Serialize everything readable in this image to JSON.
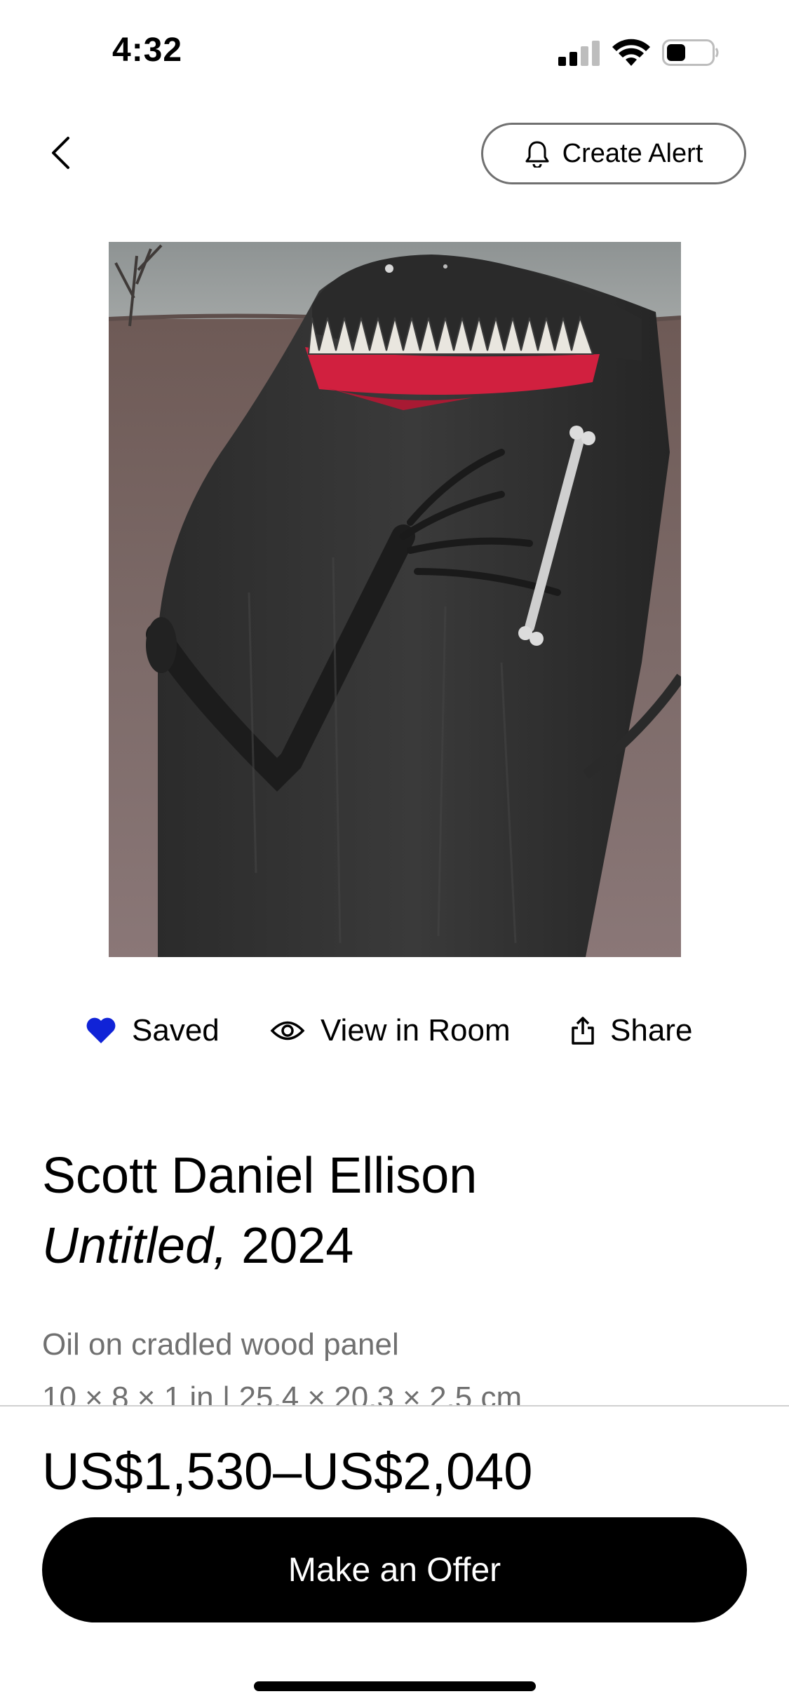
{
  "status_bar": {
    "time": "4:32",
    "icons": [
      "signal-icon",
      "wifi-icon",
      "battery-icon"
    ]
  },
  "nav": {
    "back_icon": "chevron-left-icon",
    "create_alert_label": "Create Alert",
    "create_alert_icon": "bell-icon"
  },
  "actions": {
    "saved_label": "Saved",
    "saved_icon": "heart-icon",
    "saved_color": "#1023D7",
    "view_in_room_label": "View in Room",
    "view_in_room_icon": "eye-icon",
    "share_label": "Share",
    "share_icon": "share-icon"
  },
  "artwork": {
    "artist": "Scott Daniel Ellison",
    "title": "Untitled,",
    "year": "2024",
    "medium": "Oil on cradled wood panel",
    "dimensions": "10 × 8 × 1 in | 25.4 × 20.3 × 2.5 cm"
  },
  "purchase": {
    "price_range": "US$1,530–US$2,040",
    "offer_button_label": "Make an Offer"
  }
}
